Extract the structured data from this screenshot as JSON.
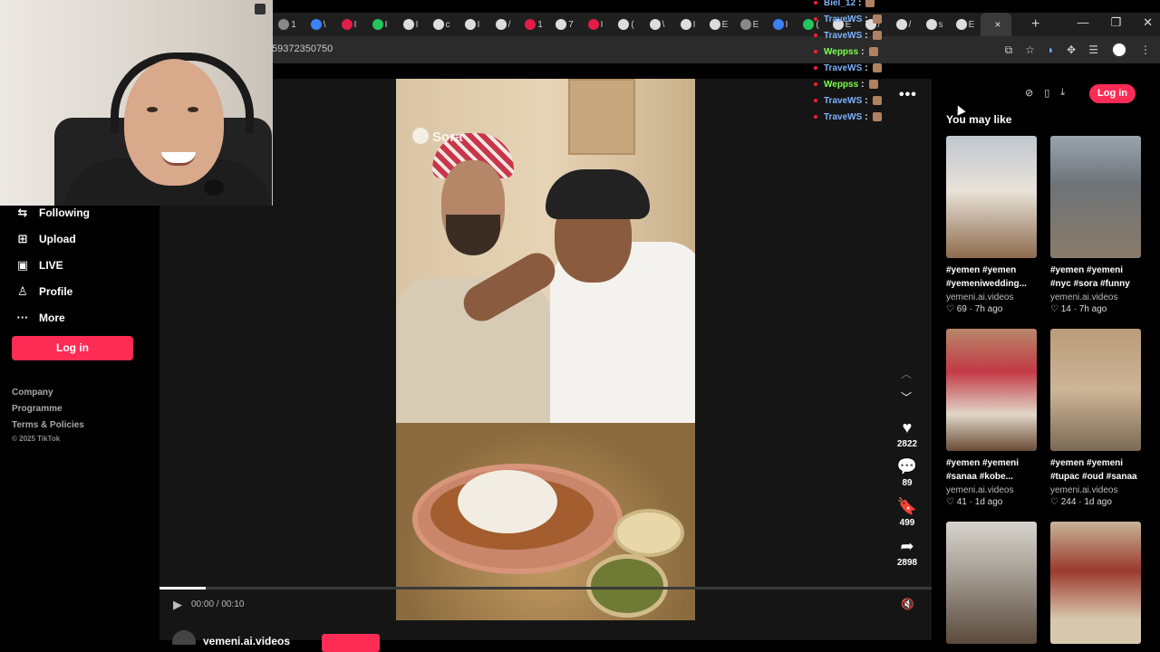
{
  "browser": {
    "tabs": [
      {
        "icon": "chrome-icon",
        "label": "1",
        "color": "#888888"
      },
      {
        "icon": "blue-circle-icon",
        "label": "\\",
        "color": "#3b82f6"
      },
      {
        "icon": "youtube-icon",
        "label": "I",
        "color": "#e11d48"
      },
      {
        "icon": "kick-icon",
        "label": "I",
        "color": "#22c55e"
      },
      {
        "icon": "tiktok-icon",
        "label": "I",
        "color": "#dddddd"
      },
      {
        "icon": "x-icon",
        "label": "c",
        "color": "#dddddd"
      },
      {
        "icon": "x-icon",
        "label": "I",
        "color": "#dddddd"
      },
      {
        "icon": "x-icon",
        "label": "/",
        "color": "#dddddd"
      },
      {
        "icon": "youtube-icon",
        "label": "1",
        "color": "#e11d48"
      },
      {
        "icon": "x-icon",
        "label": "7",
        "color": "#dddddd"
      },
      {
        "icon": "youtube-icon",
        "label": "I",
        "color": "#e11d48"
      },
      {
        "icon": "x-icon",
        "label": "(",
        "color": "#dddddd"
      },
      {
        "icon": "x-icon",
        "label": "\\",
        "color": "#dddddd"
      },
      {
        "icon": "tiktok-icon",
        "label": "I",
        "color": "#dddddd"
      },
      {
        "icon": "x-icon",
        "label": "E",
        "color": "#dddddd"
      },
      {
        "icon": "chrome-icon",
        "label": "E",
        "color": "#888888"
      },
      {
        "icon": "blue-circle-icon",
        "label": "I",
        "color": "#3b82f6"
      },
      {
        "icon": "kick-icon",
        "label": "(",
        "color": "#22c55e"
      },
      {
        "icon": "x-icon",
        "label": "E",
        "color": "#dddddd"
      },
      {
        "icon": "tiktok-icon",
        "label": "/",
        "color": "#dddddd"
      },
      {
        "icon": "x-icon",
        "label": "/",
        "color": "#dddddd"
      },
      {
        "icon": "x-icon",
        "label": "s",
        "color": "#dddddd"
      },
      {
        "icon": "x-icon",
        "label": "E",
        "color": "#dddddd"
      }
    ],
    "active_tab_close": "×",
    "new_tab": "+",
    "url": "59372350750"
  },
  "chat": [
    {
      "user": "Biel_12",
      "color": "#7fb3ff"
    },
    {
      "user": "TraveWS",
      "color": "#7fb3ff"
    },
    {
      "user": "TraveWS",
      "color": "#7fb3ff"
    },
    {
      "user": "Weppss",
      "color": "#7cff4f"
    },
    {
      "user": "TraveWS",
      "color": "#7fb3ff"
    },
    {
      "user": "Weppss",
      "color": "#7cff4f"
    },
    {
      "user": "TraveWS",
      "color": "#7fb3ff"
    },
    {
      "user": "TraveWS",
      "color": "#7fb3ff"
    }
  ],
  "sidebar": {
    "items": [
      {
        "icon": "following-icon",
        "label": "Following"
      },
      {
        "icon": "upload-icon",
        "label": "Upload"
      },
      {
        "icon": "live-icon",
        "label": "LIVE"
      },
      {
        "icon": "profile-icon",
        "label": "Profile"
      },
      {
        "icon": "more-icon",
        "label": "More"
      }
    ],
    "login_label": "Log in",
    "footer_links": [
      "Company",
      "Programme",
      "Terms & Policies"
    ],
    "copyright": "© 2025 TikTok"
  },
  "video": {
    "watermark": "Sora",
    "time": "00:00 / 00:10",
    "author": "yemeni.ai.videos",
    "progress_percent": 6,
    "actions": [
      {
        "icon": "heart-icon",
        "glyph": "♥",
        "count": "2822"
      },
      {
        "icon": "comment-icon",
        "glyph": "💬",
        "count": "89"
      },
      {
        "icon": "bookmark-icon",
        "glyph": "🔖",
        "count": "499"
      },
      {
        "icon": "share-icon",
        "glyph": "➦",
        "count": "2898"
      }
    ]
  },
  "right": {
    "login_label": "Log in",
    "section_title": "You may like",
    "cards": [
      {
        "caption": "#yemen #yemen #yemeniwedding...",
        "channel": "yemeni.ai.videos",
        "likes": "69",
        "age": "7h ago"
      },
      {
        "caption": "#yemen #yemeni #nyc #sora #funny",
        "channel": "yemeni.ai.videos",
        "likes": "14",
        "age": "7h ago"
      },
      {
        "caption": "#yemen #yemeni #sanaa #kobe...",
        "channel": "yemeni.ai.videos",
        "likes": "41",
        "age": "1d ago"
      },
      {
        "caption": "#yemen #yemeni #tupac #oud #sanaa",
        "channel": "yemeni.ai.videos",
        "likes": "244",
        "age": "1d ago"
      },
      {
        "caption": "",
        "channel": "",
        "likes": "",
        "age": ""
      },
      {
        "caption": "",
        "channel": "",
        "likes": "",
        "age": ""
      }
    ]
  },
  "colors": {
    "accent": "#fe2c55"
  }
}
